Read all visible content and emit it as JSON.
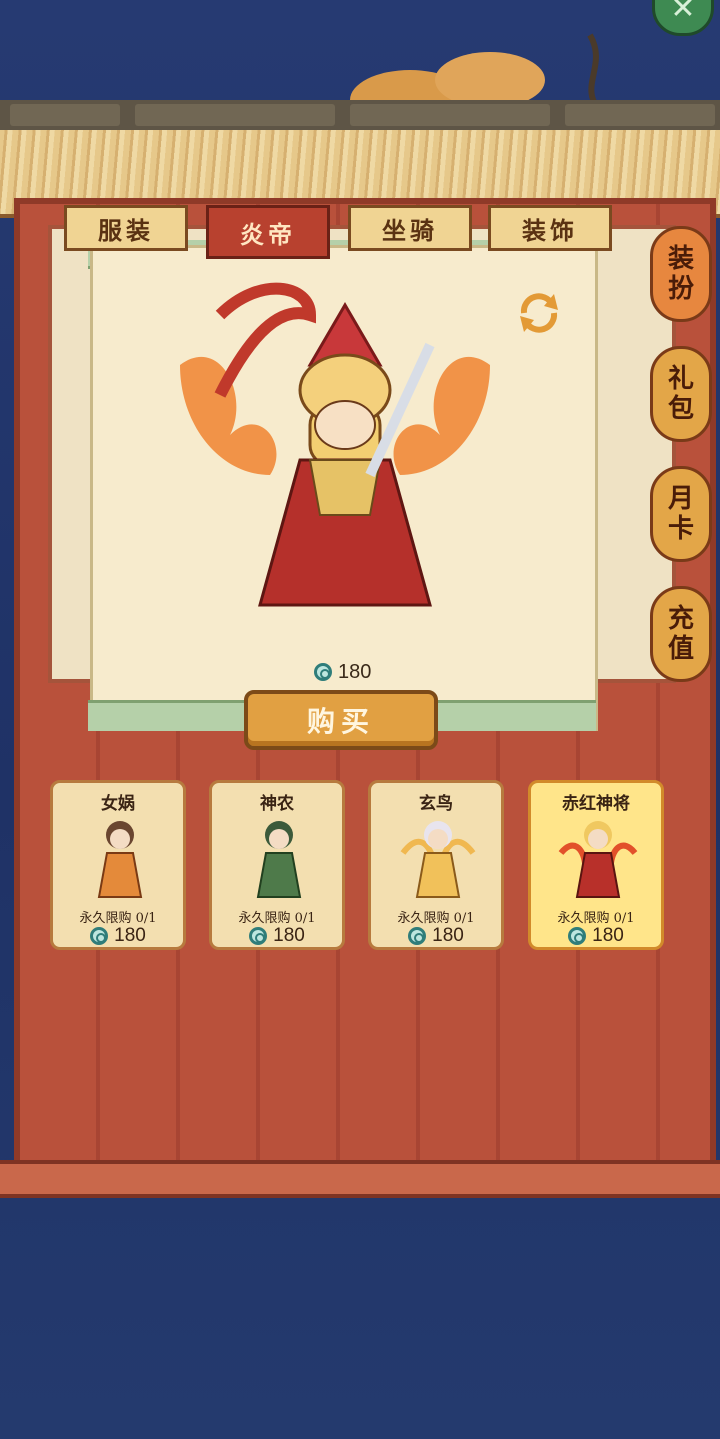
{
  "tabs": [
    {
      "label": "服装",
      "active": false
    },
    {
      "label": "炎帝",
      "active": true
    },
    {
      "label": "坐骑",
      "active": false
    },
    {
      "label": "装饰",
      "active": false
    }
  ],
  "preview": {
    "price": "180",
    "currency_icon": "jade-coin-icon"
  },
  "buy_button": "购买",
  "side_menu": [
    {
      "line1": "装",
      "line2": "扮"
    },
    {
      "line1": "礼",
      "line2": "包"
    },
    {
      "line1": "月",
      "line2": "卡"
    },
    {
      "line1": "充",
      "line2": "值"
    }
  ],
  "items": [
    {
      "name": "女娲",
      "limit": "永久限购 0/1",
      "price": "180",
      "selected": false
    },
    {
      "name": "神农",
      "limit": "永久限购 0/1",
      "price": "180",
      "selected": false
    },
    {
      "name": "玄鸟",
      "limit": "永久限购 0/1",
      "price": "180",
      "selected": false
    },
    {
      "name": "赤红神将",
      "limit": "永久限购 0/1",
      "price": "180",
      "selected": true
    }
  ],
  "colors": {
    "accent": "#b8412f",
    "gold": "#e1a042",
    "wood": "#b9513b",
    "background": "#23356a"
  }
}
